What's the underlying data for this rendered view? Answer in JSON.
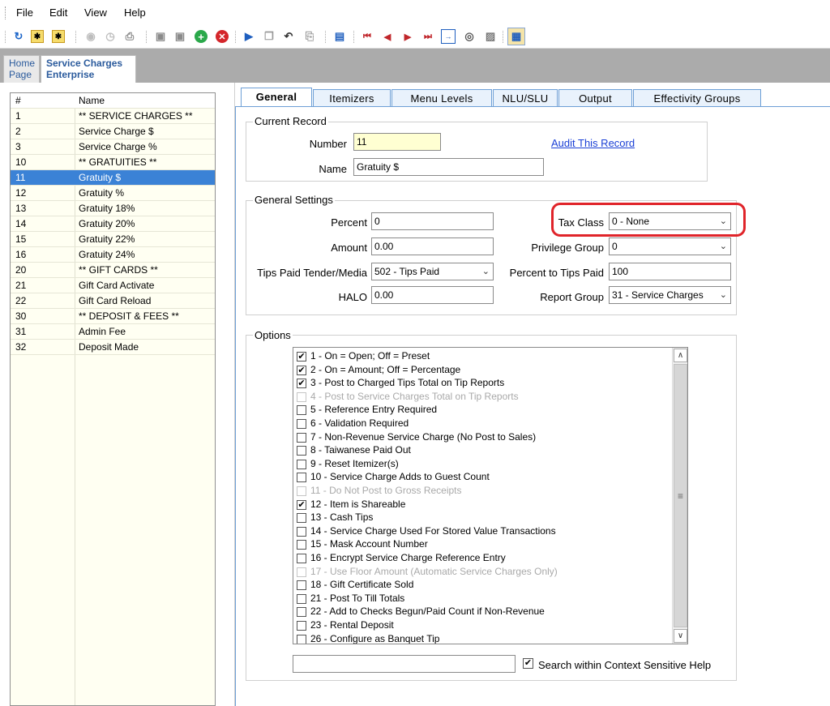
{
  "menu": [
    "File",
    "Edit",
    "View",
    "Help"
  ],
  "toolbar_icons": [
    "refresh-icon",
    "new-icon",
    "new-copy-icon",
    "circle-icon",
    "clock-icon",
    "print-icon",
    "save-icon",
    "save-all-icon",
    "add-icon",
    "delete-icon",
    "insert-icon",
    "copy-icon",
    "undo-icon",
    "paste-icon",
    "blue-doc-icon",
    "first-icon",
    "prev-icon",
    "next-icon",
    "last-icon",
    "goto-icon",
    "binoculars-icon",
    "find-icon",
    "table-icon"
  ],
  "doc_tabs": [
    {
      "line1": "Home",
      "line2": "Page"
    },
    {
      "line1": "Service Charges",
      "line2": "Enterprise"
    }
  ],
  "grid": {
    "headers": [
      "#",
      "Name"
    ],
    "rows": [
      {
        "num": "1",
        "name": "** SERVICE CHARGES **"
      },
      {
        "num": "2",
        "name": "Service Charge $"
      },
      {
        "num": "3",
        "name": "Service Charge %"
      },
      {
        "num": "10",
        "name": "** GRATUITIES **"
      },
      {
        "num": "11",
        "name": "Gratuity $",
        "selected": true
      },
      {
        "num": "12",
        "name": "Gratuity %"
      },
      {
        "num": "13",
        "name": "Gratuity 18%"
      },
      {
        "num": "14",
        "name": "Gratuity 20%"
      },
      {
        "num": "15",
        "name": "Gratuity 22%"
      },
      {
        "num": "16",
        "name": "Gratuity 24%"
      },
      {
        "num": "20",
        "name": "** GIFT CARDS **"
      },
      {
        "num": "21",
        "name": "Gift Card Activate"
      },
      {
        "num": "22",
        "name": "Gift Card Reload"
      },
      {
        "num": "30",
        "name": "** DEPOSIT & FEES **"
      },
      {
        "num": "31",
        "name": "Admin Fee"
      },
      {
        "num": "32",
        "name": "Deposit Made"
      }
    ]
  },
  "tabs": [
    "General",
    "Itemizers",
    "Menu Levels",
    "NLU/SLU",
    "Output",
    "Effectivity Groups"
  ],
  "current_record": {
    "title": "Current Record",
    "number_label": "Number",
    "number_value": "11",
    "name_label": "Name",
    "name_value": "Gratuity $",
    "audit_link": "Audit This Record"
  },
  "general_settings": {
    "title": "General Settings",
    "percent_label": "Percent",
    "percent_value": "0",
    "amount_label": "Amount",
    "amount_value": "0.00",
    "tips_label": "Tips Paid Tender/Media",
    "tips_value": "502 - Tips Paid",
    "halo_label": "HALO",
    "halo_value": "0.00",
    "tax_class_label": "Tax Class",
    "tax_class_value": "0 - None",
    "privilege_label": "Privilege Group",
    "privilege_value": "0",
    "pct_tips_label": "Percent to Tips Paid",
    "pct_tips_value": "100",
    "report_group_label": "Report Group",
    "report_group_value": "31 - Service Charges"
  },
  "options": {
    "title": "Options",
    "items": [
      {
        "label": "1 - On = Open; Off = Preset",
        "checked": true,
        "disabled": false
      },
      {
        "label": "2 - On = Amount; Off = Percentage",
        "checked": true,
        "disabled": false
      },
      {
        "label": "3 - Post to Charged Tips Total on Tip Reports",
        "checked": true,
        "disabled": false
      },
      {
        "label": "4 - Post to Service Charges Total on Tip Reports",
        "checked": false,
        "disabled": true
      },
      {
        "label": "5 - Reference Entry Required",
        "checked": false,
        "disabled": false
      },
      {
        "label": "6 - Validation Required",
        "checked": false,
        "disabled": false
      },
      {
        "label": "7 - Non-Revenue Service Charge (No Post to Sales)",
        "checked": false,
        "disabled": false
      },
      {
        "label": "8 - Taiwanese Paid Out",
        "checked": false,
        "disabled": false
      },
      {
        "label": "9 - Reset Itemizer(s)",
        "checked": false,
        "disabled": false
      },
      {
        "label": "10 - Service Charge Adds to Guest Count",
        "checked": false,
        "disabled": false
      },
      {
        "label": "11 - Do Not Post to Gross Receipts",
        "checked": false,
        "disabled": true
      },
      {
        "label": "12 - Item is Shareable",
        "checked": true,
        "disabled": false
      },
      {
        "label": "13 - Cash Tips",
        "checked": false,
        "disabled": false
      },
      {
        "label": "14 - Service Charge Used For Stored Value Transactions",
        "checked": false,
        "disabled": false
      },
      {
        "label": "15 - Mask Account Number",
        "checked": false,
        "disabled": false
      },
      {
        "label": "16 - Encrypt Service Charge Reference Entry",
        "checked": false,
        "disabled": false
      },
      {
        "label": "17 - Use Floor Amount (Automatic Service Charges Only)",
        "checked": false,
        "disabled": true
      },
      {
        "label": "18 - Gift Certificate Sold",
        "checked": false,
        "disabled": false
      },
      {
        "label": "21 - Post To Till Totals",
        "checked": false,
        "disabled": false
      },
      {
        "label": "22 - Add to Checks Begun/Paid Count if Non-Revenue",
        "checked": false,
        "disabled": false
      },
      {
        "label": "23 - Rental Deposit",
        "checked": false,
        "disabled": false
      },
      {
        "label": "26 - Configure as Banquet Tip",
        "checked": false,
        "disabled": false
      }
    ]
  },
  "help": {
    "search_value": "",
    "checkbox_label": "Search within Context Sensitive Help",
    "checked": true
  },
  "colors": {
    "selected_row": "#3b82d6",
    "highlight_ring": "#e0242a",
    "tab_border": "#6d9fd6"
  }
}
